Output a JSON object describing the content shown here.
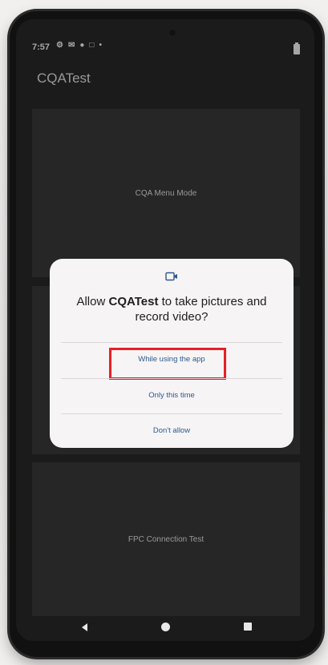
{
  "status_bar": {
    "time": "7:57",
    "icons": [
      "gear-icon",
      "mail-icon",
      "location-icon",
      "app-icon",
      "dot-icon"
    ],
    "battery": "battery-icon"
  },
  "app_bar": {
    "title": "CQATest"
  },
  "buttons": {
    "menu_mode": "CQA Menu Mode",
    "fpc_test": "FPC Connection Test"
  },
  "dialog": {
    "icon": "video-camera-icon",
    "title_prefix": "Allow ",
    "title_app": "CQATest",
    "title_suffix": " to take pictures and record video?",
    "options": [
      "While using the app",
      "Only this time",
      "Don't allow"
    ],
    "highlight_color": "#e81f25",
    "link_color": "#2d5a8c"
  },
  "nav_bar": {
    "back": "back-icon",
    "home": "home-icon",
    "recents": "recents-icon"
  }
}
